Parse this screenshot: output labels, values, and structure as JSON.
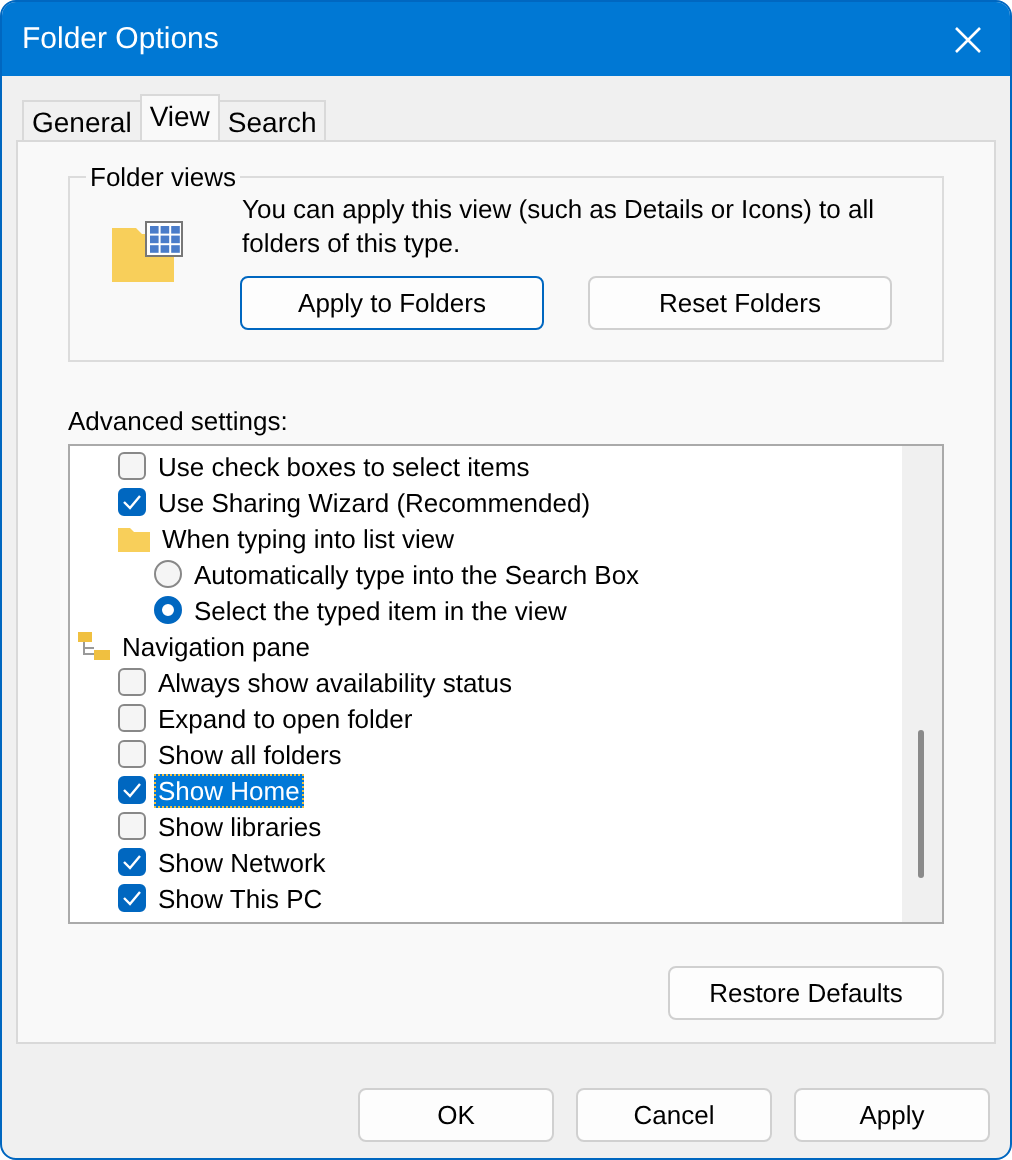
{
  "window": {
    "title": "Folder Options"
  },
  "tabs": [
    {
      "label": "General",
      "selected": false
    },
    {
      "label": "View",
      "selected": true
    },
    {
      "label": "Search",
      "selected": false
    }
  ],
  "folder_views": {
    "title": "Folder views",
    "description": "You can apply this view (such as Details or Icons) to all folders of this type.",
    "buttons": [
      {
        "label": "Apply to Folders",
        "default": true
      },
      {
        "label": "Reset Folders",
        "default": false
      }
    ]
  },
  "advanced": {
    "label": "Advanced settings:",
    "items": [
      {
        "kind": "checkbox",
        "label": "Use check boxes to select items",
        "checked": false,
        "selected": false
      },
      {
        "kind": "checkbox",
        "label": "Use Sharing Wizard (Recommended)",
        "checked": true,
        "selected": false
      },
      {
        "kind": "folder",
        "label": "When typing into list view",
        "selected": false,
        "children": [
          {
            "kind": "radio",
            "label": "Automatically type into the Search Box",
            "checked": false,
            "selected": false
          },
          {
            "kind": "radio",
            "label": "Select the typed item in the view",
            "checked": true,
            "selected": false
          }
        ]
      },
      {
        "kind": "tree",
        "label": "Navigation pane",
        "selected": false,
        "children": [
          {
            "kind": "checkbox",
            "label": "Always show availability status",
            "checked": false,
            "selected": false
          },
          {
            "kind": "checkbox",
            "label": "Expand to open folder",
            "checked": false,
            "selected": false
          },
          {
            "kind": "checkbox",
            "label": "Show all folders",
            "checked": false,
            "selected": false
          },
          {
            "kind": "checkbox",
            "label": "Show Home",
            "checked": true,
            "selected": true
          },
          {
            "kind": "checkbox",
            "label": "Show libraries",
            "checked": false,
            "selected": false
          },
          {
            "kind": "checkbox",
            "label": "Show Network",
            "checked": true,
            "selected": false
          },
          {
            "kind": "checkbox",
            "label": "Show This PC",
            "checked": true,
            "selected": false
          }
        ]
      }
    ]
  },
  "restore_button": "Restore Defaults",
  "buttons": [
    "OK",
    "Cancel",
    "Apply"
  ]
}
